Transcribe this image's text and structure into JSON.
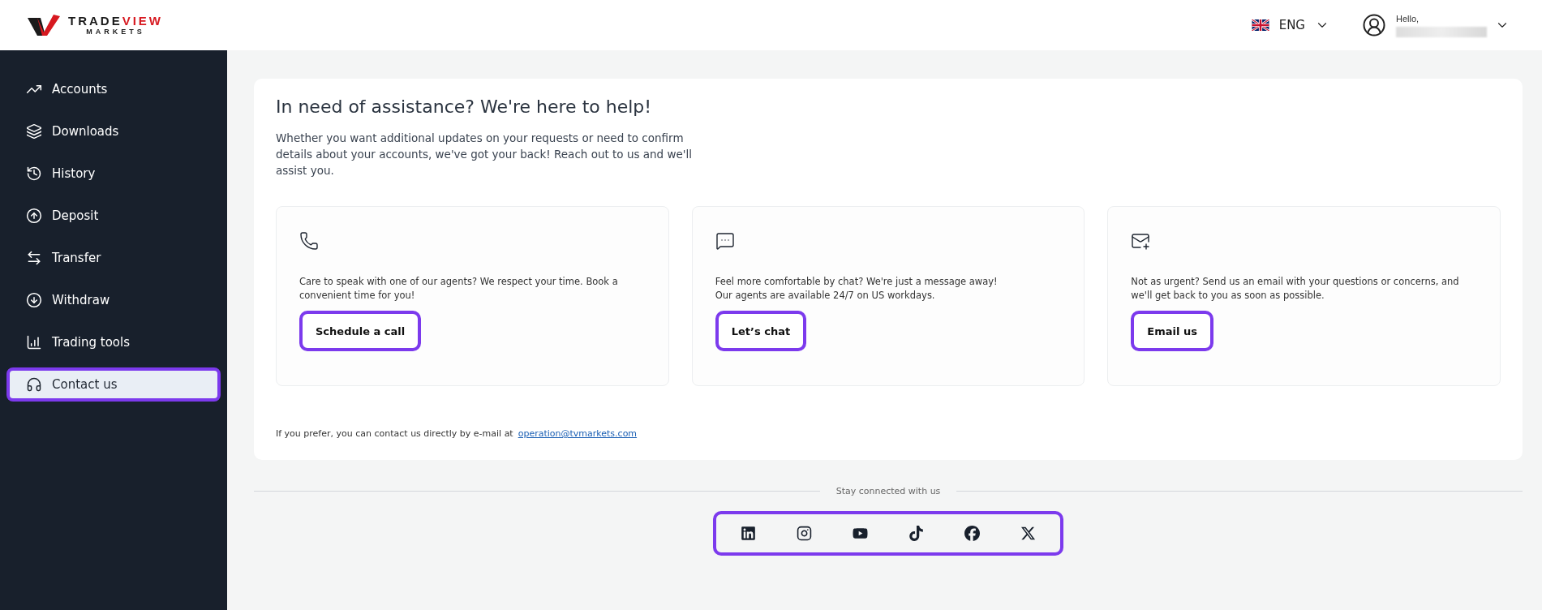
{
  "header": {
    "logo": {
      "brand_dark": "TRADE",
      "brand_accent": "VIEW",
      "tagline": "MARKETS"
    },
    "language": "ENG",
    "greeting": "Hello,"
  },
  "sidebar": {
    "items": [
      {
        "label": "Accounts",
        "selected": false,
        "highlighted": false
      },
      {
        "label": "Downloads",
        "selected": false,
        "highlighted": false
      },
      {
        "label": "History",
        "selected": false,
        "highlighted": false
      },
      {
        "label": "Deposit",
        "selected": false,
        "highlighted": false
      },
      {
        "label": "Transfer",
        "selected": false,
        "highlighted": false
      },
      {
        "label": "Withdraw",
        "selected": false,
        "highlighted": false
      },
      {
        "label": "Trading tools",
        "selected": false,
        "highlighted": false
      },
      {
        "label": "Contact us",
        "selected": true,
        "highlighted": true
      }
    ]
  },
  "main": {
    "title": "In need of assistance? We're here to help!",
    "intro": "Whether you want additional updates on your requests or need to confirm details about your accounts, we've got your back! Reach out to us and we'll assist you.",
    "options": [
      {
        "text": "Care to speak with one of our agents? We respect your time. Book a convenient time for you!",
        "button": "Schedule a call",
        "highlighted": true
      },
      {
        "text": "Feel more comfortable by chat? We're just a message away!\nOur agents are available 24/7 on US workdays.",
        "button": "Let’s chat",
        "highlighted": true
      },
      {
        "text": "Not as urgent? Send us an email with your questions or concerns, and we'll get back to you as soon as possible.",
        "button": "Email us",
        "highlighted": true
      }
    ],
    "email_note": "If you prefer, you can contact us directly by e-mail at",
    "email": "operation@tvmarkets.com"
  },
  "footer": {
    "caption": "Stay connected with us",
    "highlighted": true
  }
}
